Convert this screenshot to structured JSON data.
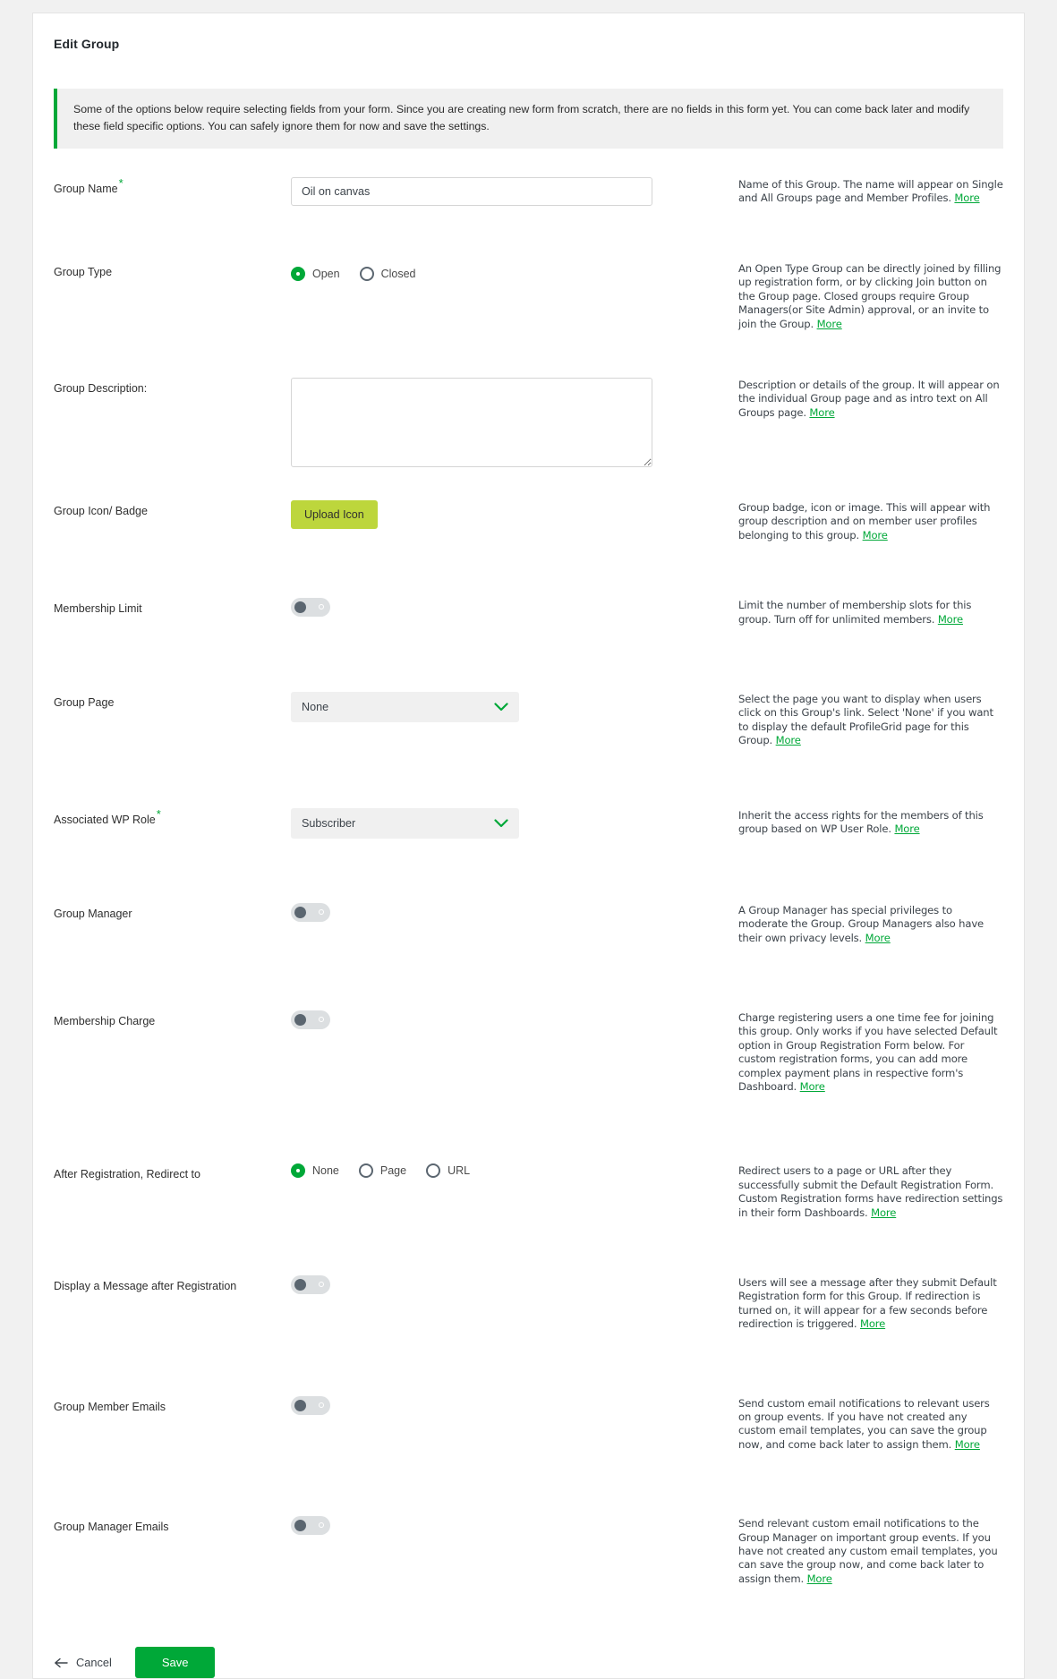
{
  "card": {
    "title": "Edit Group",
    "notice": "Some of the options below require selecting fields from your form. Since you are creating new form from scratch, there are no fields in this form yet. You can come back later and modify these field specific options. You can safely ignore them for now and save the settings."
  },
  "colors": {
    "accent_green": "#00a838",
    "upload_button": "#bdd63c",
    "toggle_track": "#dcdfe1",
    "toggle_knob": "#5b6670",
    "notice_bg": "#f0f0f0"
  },
  "more_label": "More",
  "fields": {
    "group_name": {
      "label": "Group Name",
      "required": true,
      "value": "Oil on canvas",
      "placeholder": "",
      "help": "Name of this Group. The name will appear on Single and All Groups page and Member Profiles."
    },
    "group_type": {
      "label": "Group Type",
      "required": false,
      "options": [
        "Open",
        "Closed"
      ],
      "selected": "Open",
      "help": "An Open Type Group can be directly joined by filling up registration form, or by clicking Join button on the Group page. Closed groups require Group Managers(or Site Admin) approval, or an invite to join the Group."
    },
    "group_description": {
      "label": "Group Description:",
      "required": false,
      "value": "",
      "placeholder": "",
      "help": "Description or details of the group. It will appear on the individual Group page and as intro text on All Groups page."
    },
    "group_icon": {
      "label": "Group Icon/ Badge",
      "required": false,
      "button_label": "Upload Icon",
      "help": "Group badge, icon or image. This will appear with group description and on member user profiles belonging to this group."
    },
    "membership_limit": {
      "label": "Membership Limit",
      "required": false,
      "state": "off",
      "help": "Limit the number of membership slots for this group. Turn off for unlimited members."
    },
    "group_page": {
      "label": "Group Page",
      "required": false,
      "value": "None",
      "options": [
        "None"
      ],
      "help": "Select the page you want to display when users click on this Group's link. Select 'None' if you want to display the default ProfileGrid page for this Group."
    },
    "wp_role": {
      "label": "Associated WP Role",
      "required": true,
      "value": "Subscriber",
      "options": [
        "Subscriber"
      ],
      "help": "Inherit the access rights for the members of this group based on WP User Role."
    },
    "group_manager": {
      "label": "Group Manager",
      "required": false,
      "state": "off",
      "help": "A Group Manager has special privileges to moderate the Group. Group Managers also have their own privacy levels."
    },
    "membership_charge": {
      "label": "Membership Charge",
      "required": false,
      "state": "off",
      "help": "Charge registering users a one time fee for joining this group. Only works if you have selected Default option in Group Registration Form below. For custom registration forms, you can add more complex payment plans in respective form's Dashboard."
    },
    "redirect": {
      "label": "After Registration, Redirect to",
      "required": false,
      "options": [
        "None",
        "Page",
        "URL"
      ],
      "selected": "None",
      "help": "Redirect users to a page or URL after they successfully submit the Default Registration Form. Custom Registration forms have redirection settings in their form Dashboards."
    },
    "display_message": {
      "label": "Display a Message after Registration",
      "required": false,
      "state": "off",
      "help": "Users will see a message after they submit Default Registration form for this Group. If redirection is turned on, it will appear for a few seconds before redirection is triggered."
    },
    "member_emails": {
      "label": "Group Member Emails",
      "required": false,
      "state": "off",
      "help": "Send custom email notifications to relevant users on group events. If you have not created any custom email templates, you can save the group now, and come back later to assign them."
    },
    "manager_emails": {
      "label": "Group Manager Emails",
      "required": false,
      "state": "off",
      "help": "Send relevant custom email notifications to the Group Manager on important group events. If you have not created any custom email templates, you can save the group now, and come back later to assign them."
    }
  },
  "footer": {
    "cancel_label": "Cancel",
    "save_label": "Save"
  }
}
